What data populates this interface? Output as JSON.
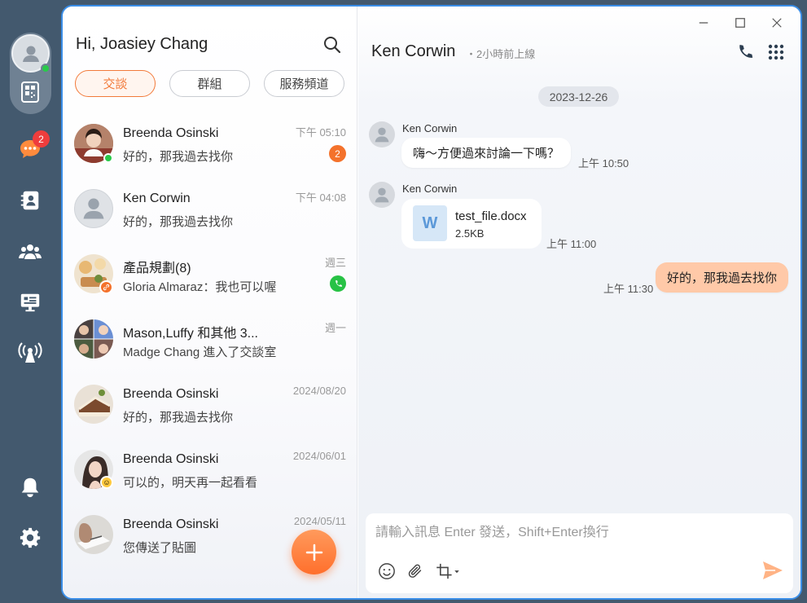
{
  "rail": {
    "unread_badge": "2",
    "icons": [
      "user-avatar-icon",
      "qr-code-icon",
      "chat-bubble-icon",
      "contacts-icon",
      "group-icon",
      "presentation-icon",
      "broadcast-icon",
      "bell-icon",
      "gear-icon"
    ]
  },
  "header": {
    "greeting": "Hi, Joasiey Chang"
  },
  "tabs": [
    "交談",
    "群組",
    "服務頻道"
  ],
  "conversations": [
    {
      "name": "Breenda Osinski",
      "preview": "好的，那我過去找你",
      "time": "下午 05:10",
      "badge": "2"
    },
    {
      "name": "Ken Corwin",
      "preview": "好的，那我過去找你",
      "time": "下午 04:08"
    },
    {
      "name": "產品規劃(8)",
      "preview": "Gloria Almaraz：我也可以喔",
      "time": "週三"
    },
    {
      "name": "Mason,Luffy 和其他 3...",
      "preview": "Madge Chang 進入了交談室",
      "time": "週一"
    },
    {
      "name": "Breenda Osinski",
      "preview": "好的，那我過去找你",
      "time": "2024/08/20"
    },
    {
      "name": "Breenda Osinski",
      "preview": "可以的，明天再一起看看",
      "time": "2024/06/01"
    },
    {
      "name": "Breenda Osinski",
      "preview": "您傳送了貼圖",
      "time": "2024/05/11"
    }
  ],
  "chat": {
    "title": "Ken Corwin",
    "status": "・2小時前上線",
    "date": "2023-12-26",
    "messages": [
      {
        "sender": "Ken Corwin",
        "text": "嗨～方便過來討論一下嗎？",
        "time": "上午 10:50"
      },
      {
        "sender": "Ken Corwin",
        "file_name": "test_file.docx",
        "file_size": "2.5KB",
        "file_icon": "W",
        "time": "上午 11:00"
      },
      {
        "text": "好的，那我過去找你",
        "time": "上午 11:30"
      }
    ],
    "composer_placeholder": "請輸入訊息 Enter 發送，Shift+Enter換行"
  },
  "colors": {
    "accent": "#f27a3a",
    "rail": "#43596e",
    "window_border": "#3a8ee8",
    "my_bubble": "#ffc9a8",
    "online": "#29c94a"
  }
}
